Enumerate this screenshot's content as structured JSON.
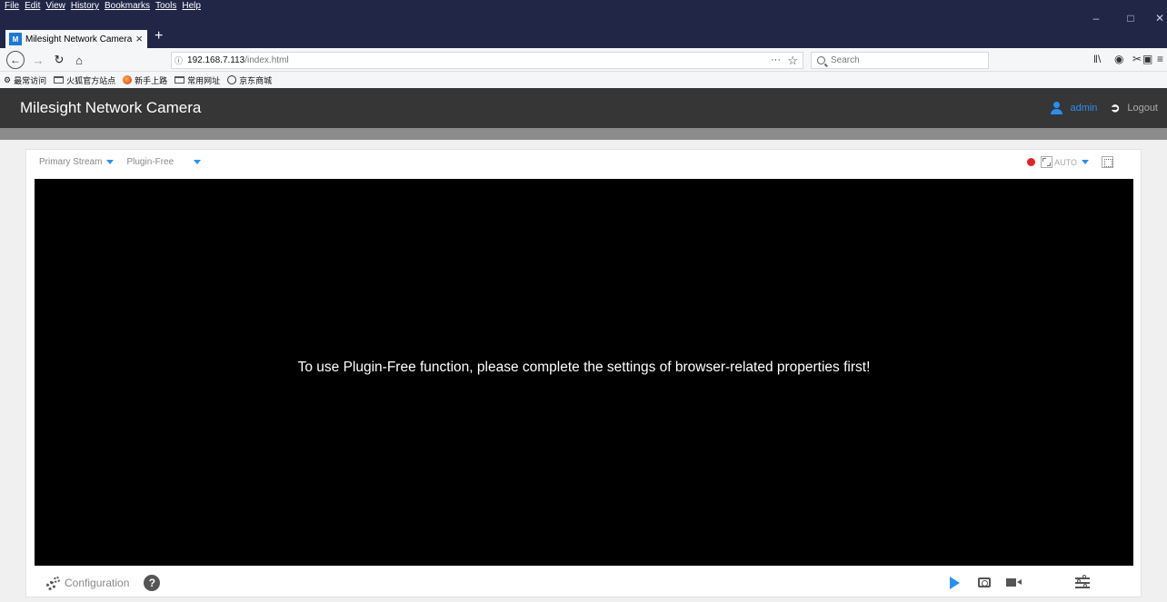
{
  "browser": {
    "menu": [
      "File",
      "Edit",
      "View",
      "History",
      "Bookmarks",
      "Tools",
      "Help"
    ],
    "tab_title": "Milesight Network Camera",
    "favicon_text": "M",
    "url_host": "192.168.7.113",
    "url_path": "/index.html",
    "search_placeholder": "Search",
    "bookmarks": [
      "最常访问",
      "火狐官方站点",
      "新手上路",
      "常用网址",
      "京东商城"
    ]
  },
  "app": {
    "title": "Milesight Network Camera",
    "user": "admin",
    "logout": "Logout",
    "stream_select": "Primary Stream",
    "mode_select": "Plugin-Free",
    "zoom_select": "AUTO",
    "video_message": "To use Plugin-Free function, please complete the settings of browser-related properties first!",
    "configuration": "Configuration",
    "help": "?"
  },
  "colors": {
    "accent": "#2a8ff1",
    "header_bg": "#363636",
    "browser_bg": "#212646",
    "record": "#e02525"
  }
}
